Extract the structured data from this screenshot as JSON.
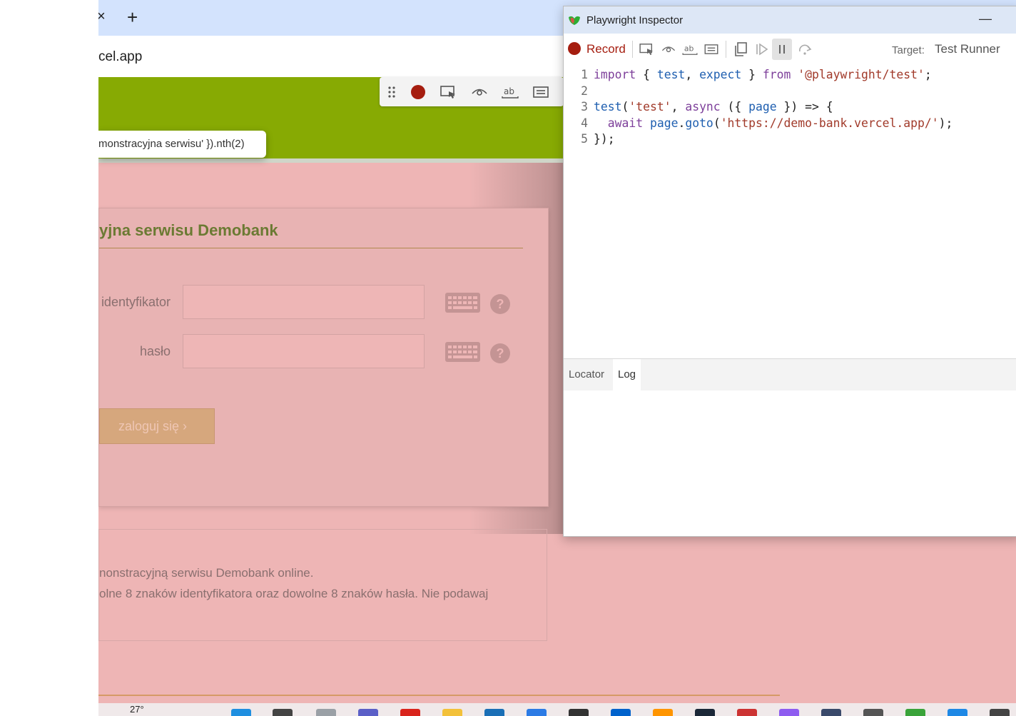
{
  "browser": {
    "tab_close": "×",
    "new_tab": "+",
    "url": "cel.app"
  },
  "page": {
    "tooltip": "monstracyjna serwisu' }).nth(2)",
    "login_title": "yjna serwisu Demobank",
    "identifier_label": "identyfikator",
    "password_label": "hasło",
    "help_glyph": "?",
    "login_button": "zaloguj się ›",
    "info_line_1": "nonstracyjną serwisu Demobank online.",
    "info_line_2": "olne 8 znaków identyfikatora oraz dowolne 8 znaków hasła. Nie podawaj",
    "weather_temp": "27°"
  },
  "inspector": {
    "title": "Playwright Inspector",
    "minimize": "—",
    "record_label": "Record",
    "target_label": "Target:",
    "target_value": "Test Runner",
    "tabs": [
      "Locator",
      "Log"
    ],
    "code_line_numbers": [
      "1",
      "2",
      "3",
      "4",
      "5"
    ]
  },
  "colors": {
    "record_red": "#a51d0f",
    "header_green": "#87aa03",
    "page_pink": "#eeb5b5"
  },
  "icons": [
    "drag-handle-icon",
    "record-icon",
    "pick-locator-icon",
    "assert-visibility-icon",
    "assert-text-icon",
    "assert-value-icon",
    "copy-icon",
    "resume-icon",
    "pause-icon",
    "step-over-icon",
    "keyboard-icon",
    "help-icon",
    "playwright-logo-icon"
  ]
}
